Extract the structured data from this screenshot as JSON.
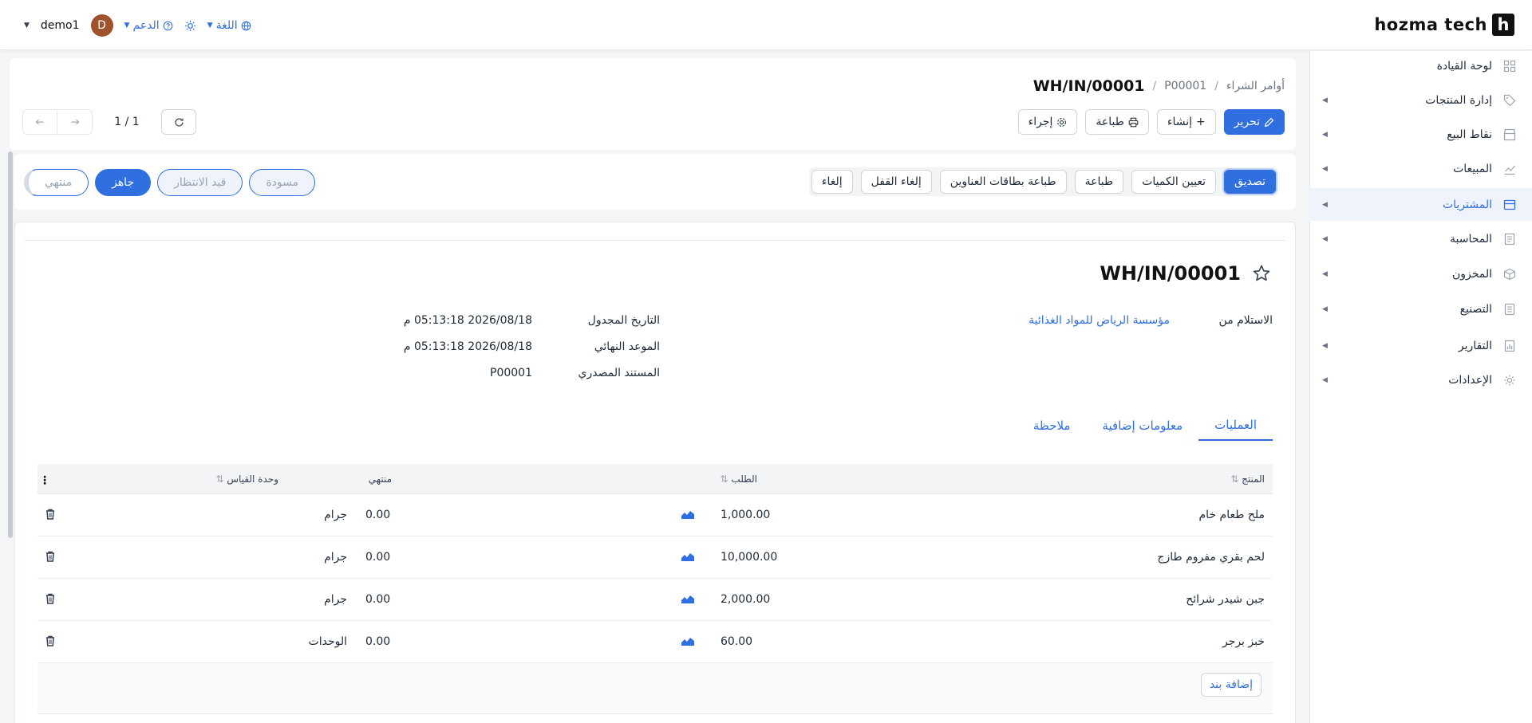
{
  "brand": {
    "name": "hozma tech",
    "mark": "h"
  },
  "topbar": {
    "user": "demo1",
    "avatar_letter": "D",
    "support": "الدعم",
    "language": "اللغة"
  },
  "sidebar": {
    "items": [
      {
        "label": "لوحة القيادة",
        "icon": "grid-icon",
        "arrow": false,
        "active": false
      },
      {
        "label": "إدارة المنتجات",
        "icon": "tag-icon",
        "arrow": true,
        "active": false
      },
      {
        "label": "نقاط البيع",
        "icon": "store-icon",
        "arrow": true,
        "active": false
      },
      {
        "label": "المبيعات",
        "icon": "chart-line-icon",
        "arrow": true,
        "active": false
      },
      {
        "label": "المشتريات",
        "icon": "card-icon",
        "arrow": true,
        "active": true
      },
      {
        "label": "المحاسبة",
        "icon": "ledger-icon",
        "arrow": true,
        "active": false
      },
      {
        "label": "المخزون",
        "icon": "box-icon",
        "arrow": true,
        "active": false
      },
      {
        "label": "التصنيع",
        "icon": "document-icon",
        "arrow": true,
        "active": false
      },
      {
        "label": "التقارير",
        "icon": "report-icon",
        "arrow": true,
        "active": false
      },
      {
        "label": "الإعدادات",
        "icon": "gear-icon",
        "arrow": true,
        "active": false
      }
    ]
  },
  "breadcrumb": {
    "root": "أوامر الشراء",
    "parent": "P00001",
    "current": "WH/IN/00001"
  },
  "actions": {
    "edit": "تحرير",
    "create": "إنشاء",
    "print": "طباعة",
    "action": "إجراء"
  },
  "pager": {
    "count": "1 / 1"
  },
  "status_buttons": {
    "validate": "تصديق",
    "set_quantities": "تعيين الكميات",
    "print": "طباعة",
    "print_labels": "طباعة بطاقات العناوين",
    "unlock": "إلغاء القفل",
    "cancel": "إلغاء"
  },
  "stages": {
    "draft": "مسودة",
    "waiting": "قيد الانتظار",
    "ready": "جاهز",
    "done": "منتهي"
  },
  "form": {
    "title": "WH/IN/00001",
    "receive_from_label": "الاستلام من",
    "receive_from_value": "مؤسسة الرياض للمواد الغذائية",
    "scheduled_label": "التاريخ المجدول",
    "scheduled_value": "2026/08/18 05:13:18 م",
    "deadline_label": "الموعد النهائي",
    "deadline_value": "2026/08/18 05:13:18 م",
    "source_label": "المستند المصدري",
    "source_value": "P00001"
  },
  "tabs": {
    "operations": "العمليات",
    "extra_info": "معلومات إضافية",
    "note": "ملاحظة"
  },
  "table": {
    "headers": {
      "product": "المنتج",
      "demand": "الطلب",
      "done": "منتهي",
      "uom": "وحدة القياس"
    },
    "rows": [
      {
        "product": "ملح طعام خام",
        "demand": "1,000.00",
        "done": "0.00",
        "uom": "جرام"
      },
      {
        "product": "لحم بقري مفروم طازج",
        "demand": "10,000.00",
        "done": "0.00",
        "uom": "جرام"
      },
      {
        "product": "جبن شيدر شرائح",
        "demand": "2,000.00",
        "done": "0.00",
        "uom": "جرام"
      },
      {
        "product": "خبز برجر",
        "demand": "60.00",
        "done": "0.00",
        "uom": "الوحدات"
      }
    ],
    "add_line": "إضافة بند"
  },
  "colors": {
    "accent": "#2f6fdf",
    "avatar": "#a0522d"
  }
}
